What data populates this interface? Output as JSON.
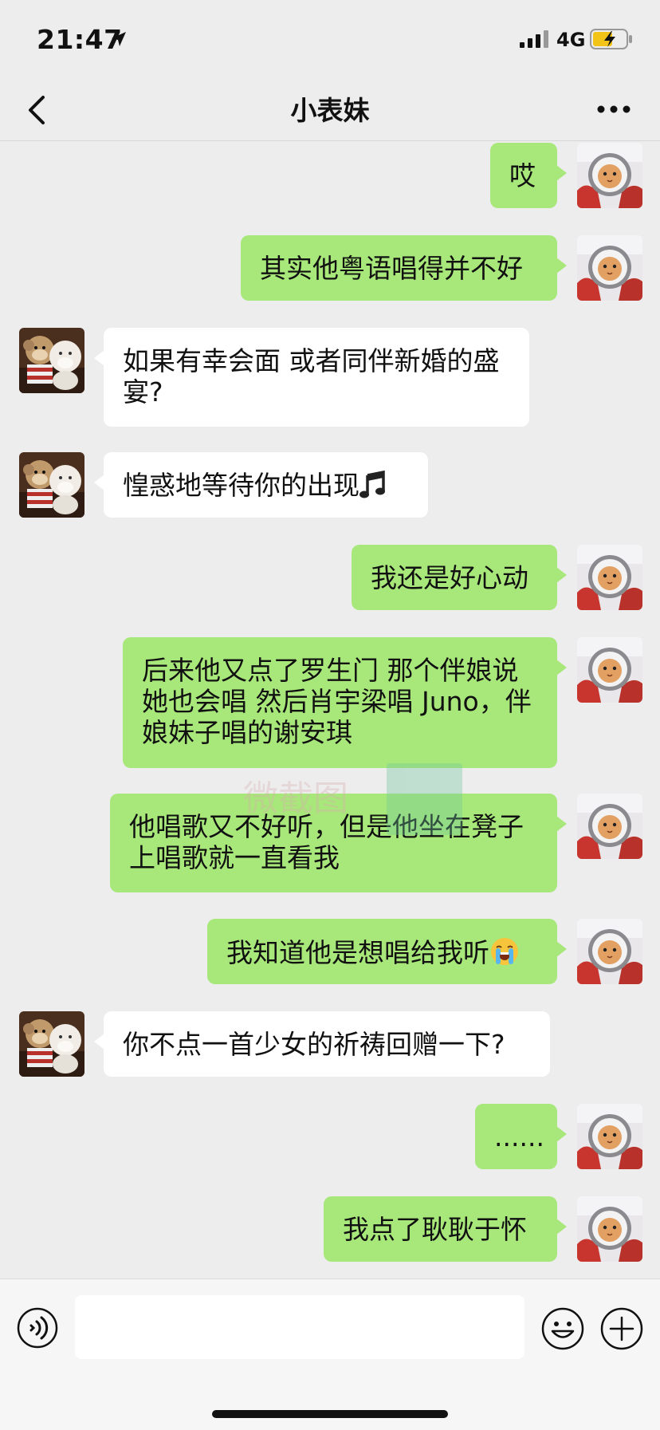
{
  "status": {
    "time": "21:47",
    "network": "4G"
  },
  "nav": {
    "title": "小表妹"
  },
  "messages": [
    {
      "side": "out",
      "text": "哎"
    },
    {
      "side": "out",
      "text": "其实他粤语唱得并不好"
    },
    {
      "side": "in",
      "text": "如果有幸会面 或者同伴新婚的盛\n宴?"
    },
    {
      "side": "in",
      "text": "惶惑地等待你的出现",
      "emoji": "music-note"
    },
    {
      "side": "out",
      "text": "我还是好心动"
    },
    {
      "side": "out",
      "text": "后来他又点了罗生门 那个伴娘说\n她也会唱 然后肖宇梁唱 Juno，伴\n娘妹子唱的谢安琪"
    },
    {
      "side": "out",
      "text": "他唱歌又不好听，但是他坐在凳子\n上唱歌就一直看我"
    },
    {
      "side": "out",
      "text": "我知道他是想唱给我听",
      "emoji": "loudly-crying-face"
    },
    {
      "side": "in",
      "text": "你不点一首少女的祈祷回赠一下?"
    },
    {
      "side": "out",
      "text": "......"
    },
    {
      "side": "out",
      "text": "我点了耿耿于怀"
    }
  ],
  "watermark": {
    "text": "微截图"
  },
  "input": {
    "value": ""
  },
  "colors": {
    "outgoing_bubble": "#a8e77a",
    "incoming_bubble": "#ffffff",
    "background": "#ededed"
  }
}
